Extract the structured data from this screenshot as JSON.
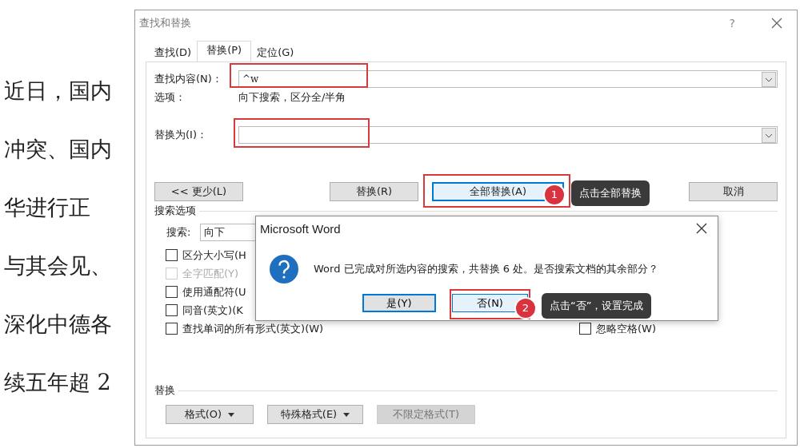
{
  "document": {
    "lines": [
      "近日，国内",
      "冲突、国内",
      "华进行正",
      "与其会见、",
      "深化中德各",
      "续五年超 2"
    ]
  },
  "dialog": {
    "title": "查找和替换",
    "help": "?",
    "tabs": [
      {
        "label": "查找(D)",
        "selected": false
      },
      {
        "label": "替换(P)",
        "selected": true
      },
      {
        "label": "定位(G)",
        "selected": false
      }
    ],
    "find": {
      "label": "查找内容(N)：",
      "value": "^w"
    },
    "options": {
      "label": "选项：",
      "value": "向下搜索，区分全/半角"
    },
    "replace": {
      "label": "替换为(I)："
    },
    "buttons": [
      {
        "label": "<< 更少(L)",
        "focused": false
      },
      {
        "label": "替换(R)",
        "focused": false
      },
      {
        "label": "全部替换(A)",
        "focused": true
      },
      {
        "label": "取消",
        "focused": false
      }
    ],
    "search_options": {
      "heading": "搜索选项",
      "search_label": "搜索:",
      "search_value": "向下",
      "checkboxes": [
        {
          "label": "区分大小写(H",
          "checked": false,
          "disabled": false
        },
        {
          "label": "全字匹配(Y)",
          "checked": false,
          "disabled": true
        },
        {
          "label": "使用通配符(U",
          "checked": false,
          "disabled": false
        },
        {
          "label": "同音(英文)(K",
          "checked": false,
          "disabled": false
        },
        {
          "label": "查找单词的所有形式(英文)(W)",
          "checked": false,
          "disabled": false
        }
      ],
      "right_checkboxes": [
        {
          "label": "忽略空格(W)",
          "checked": false,
          "disabled": false
        }
      ]
    },
    "replace_section": {
      "heading": "替换",
      "buttons": [
        {
          "label": "格式(O)",
          "dropdown": true,
          "disabled": false
        },
        {
          "label": "特殊格式(E)",
          "dropdown": true,
          "disabled": false
        },
        {
          "label": "不限定格式(T)",
          "dropdown": false,
          "disabled": true
        }
      ]
    }
  },
  "message_box": {
    "title": "Microsoft Word",
    "message": "Word 已完成对所选内容的搜索，共替换 6 处。是否搜索文档的其余部分？",
    "buttons": [
      {
        "label": "是(Y)",
        "focused": true
      },
      {
        "label": "否(N)",
        "focused": false
      }
    ]
  },
  "annotations": [
    {
      "number": "1",
      "text": "点击全部替换"
    },
    {
      "number": "2",
      "text": "点击“否”，设置完成"
    }
  ]
}
